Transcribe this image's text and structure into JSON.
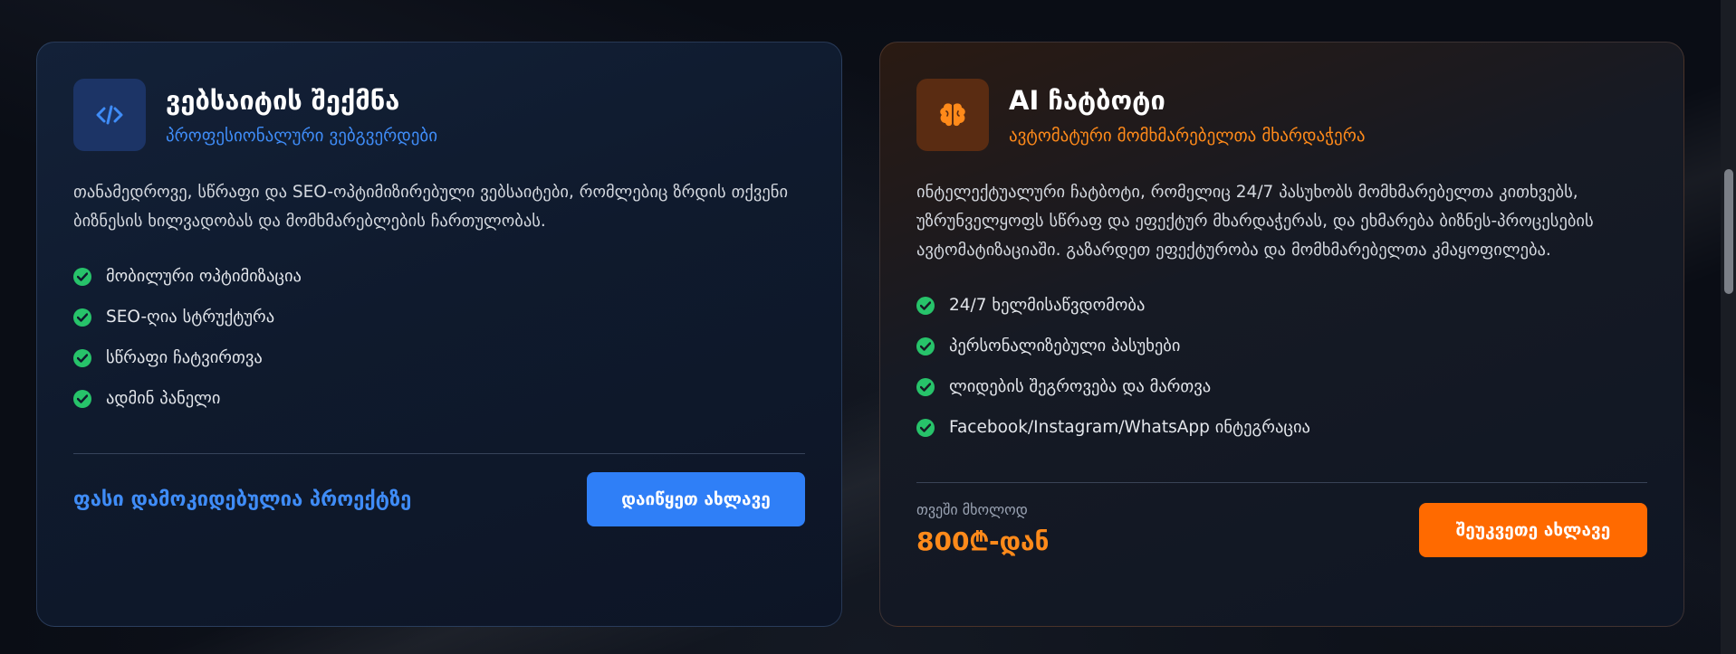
{
  "cards": {
    "web": {
      "title": "ვებსაიტის შექმნა",
      "subtitle": "პროფესიონალური ვებგვერდები",
      "icon": "code-icon",
      "description": "თანამედროვე, სწრაფი და SEO-ოპტიმიზირებული ვებსაიტები, რომლებიც ზრდის თქვენი ბიზნესის ხილვადობას და მომხმარებლების ჩართულობას.",
      "features": [
        "მობილური ოპტიმიზაცია",
        "SEO-ღია სტრუქტურა",
        "სწრაფი ჩატვირთვა",
        "ადმინ პანელი"
      ],
      "price_text": "ფასი დამოკიდებულია პროექტზე",
      "button_label": "დაიწყეთ ახლავე",
      "accent": "#2f7ff7"
    },
    "ai": {
      "title": "AI ჩატბოტი",
      "subtitle": "ავტომატური მომხმარებელთა მხარდაჭერა",
      "icon": "brain-icon",
      "description": "ინტელექტუალური ჩატბოტი, რომელიც 24/7 პასუხობს მომხმარებელთა კითხვებს, უზრუნველყოფს სწრაფ და ეფექტურ მხარდაჭერას, და ეხმარება ბიზნეს-პროცესების ავტომატიზაციაში. გაზარდეთ ეფექტურობა და მომხმარებელთა კმაყოფილება.",
      "features": [
        "24/7 ხელმისაწვდომობა",
        "პერსონალიზებული პასუხები",
        "ლიდების შეგროვება და მართვა",
        "Facebook/Instagram/WhatsApp ინტეგრაცია"
      ],
      "price_label": "თვეში მხოლოდ",
      "price_value": "800₾-დან",
      "button_label": "შეუკვეთე ახლავე",
      "accent": "#ff6a00"
    }
  }
}
